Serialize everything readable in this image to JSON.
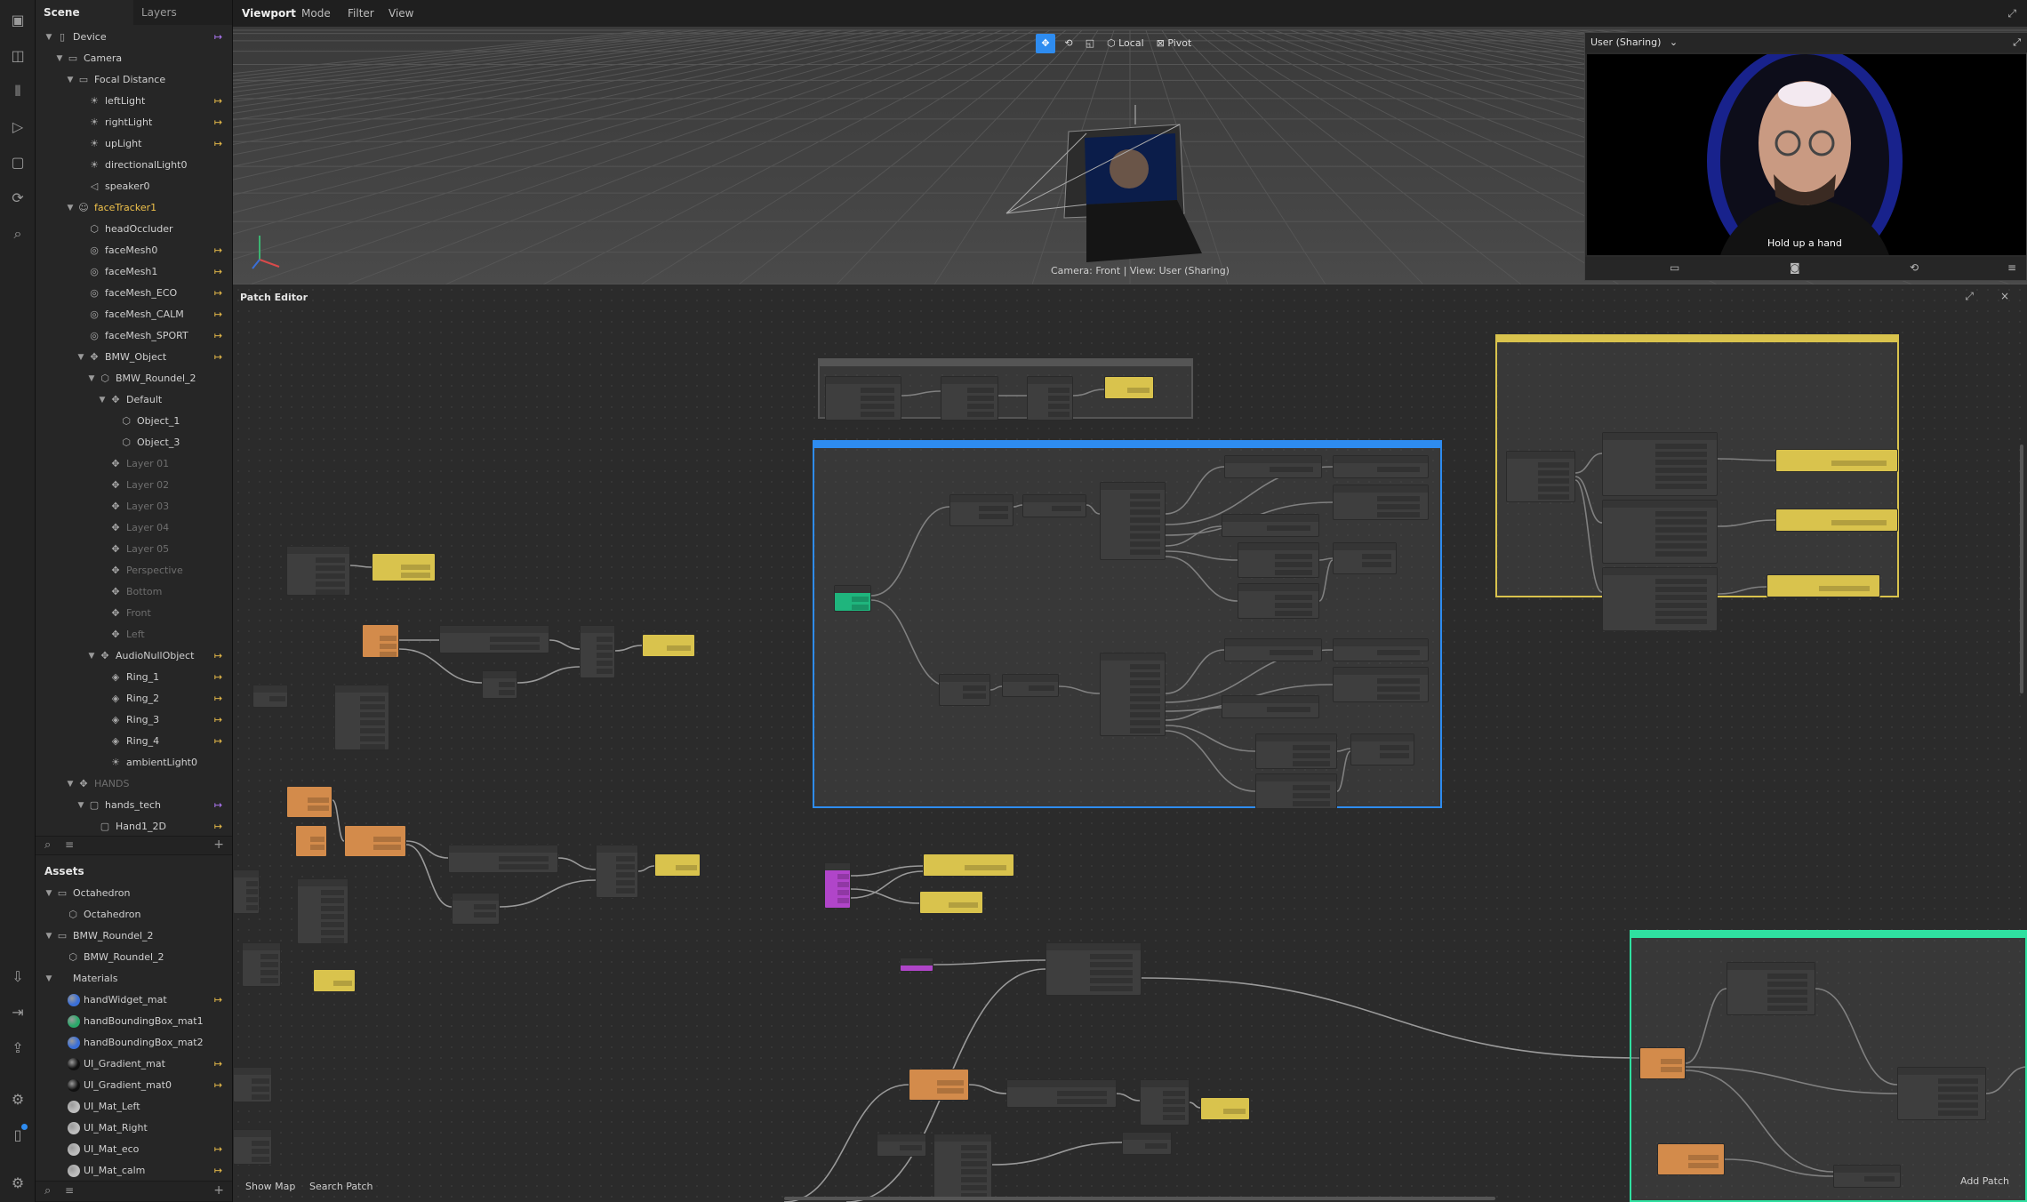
{
  "toolbar": {
    "icons": [
      "layout-icon",
      "camera-icon",
      "columns-icon",
      "play-icon",
      "square-icon",
      "sync-icon",
      "search-icon",
      "import-icon",
      "export-icon",
      "share-icon",
      "debug-icon",
      "device-icon",
      "settings-icon"
    ]
  },
  "scene": {
    "tabs": [
      "Scene",
      "Layers"
    ],
    "rows": [
      {
        "label": "Device",
        "depth": 0,
        "arrow": "▼",
        "icon": "▯",
        "pin": "↦",
        "pin_color": "purple"
      },
      {
        "label": "Camera",
        "depth": 1,
        "arrow": "▼",
        "icon": "▭"
      },
      {
        "label": "Focal Distance",
        "depth": 2,
        "arrow": "▼",
        "icon": "▭"
      },
      {
        "label": "leftLight",
        "depth": 3,
        "icon": "☀",
        "pin": "↦"
      },
      {
        "label": "rightLight",
        "depth": 3,
        "icon": "☀",
        "pin": "↦"
      },
      {
        "label": "upLight",
        "depth": 3,
        "icon": "☀",
        "pin": "↦"
      },
      {
        "label": "directionalLight0",
        "depth": 3,
        "icon": "☀"
      },
      {
        "label": "speaker0",
        "depth": 3,
        "icon": "◁"
      },
      {
        "label": "faceTracker1",
        "depth": 2,
        "arrow": "▼",
        "icon": "☺",
        "highlight": true
      },
      {
        "label": "headOccluder",
        "depth": 3,
        "icon": "⬡"
      },
      {
        "label": "faceMesh0",
        "depth": 3,
        "icon": "◎",
        "pin": "↦"
      },
      {
        "label": "faceMesh1",
        "depth": 3,
        "icon": "◎",
        "pin": "↦"
      },
      {
        "label": "faceMesh_ECO",
        "depth": 3,
        "icon": "◎",
        "pin": "↦"
      },
      {
        "label": "faceMesh_CALM",
        "depth": 3,
        "icon": "◎",
        "pin": "↦"
      },
      {
        "label": "faceMesh_SPORT",
        "depth": 3,
        "icon": "◎",
        "pin": "↦"
      },
      {
        "label": "BMW_Object",
        "depth": 3,
        "arrow": "▼",
        "icon": "✥",
        "pin": "↦"
      },
      {
        "label": "BMW_Roundel_2",
        "depth": 4,
        "arrow": "▼",
        "icon": "⬡"
      },
      {
        "label": "Default",
        "depth": 5,
        "arrow": "▼",
        "icon": "✥"
      },
      {
        "label": "Object_1",
        "depth": 6,
        "icon": "⬡"
      },
      {
        "label": "Object_3",
        "depth": 6,
        "icon": "⬡"
      },
      {
        "label": "Layer 01",
        "depth": 5,
        "icon": "✥",
        "dim": true
      },
      {
        "label": "Layer 02",
        "depth": 5,
        "icon": "✥",
        "dim": true
      },
      {
        "label": "Layer 03",
        "depth": 5,
        "icon": "✥",
        "dim": true
      },
      {
        "label": "Layer 04",
        "depth": 5,
        "icon": "✥",
        "dim": true
      },
      {
        "label": "Layer 05",
        "depth": 5,
        "icon": "✥",
        "dim": true
      },
      {
        "label": "Perspective",
        "depth": 5,
        "icon": "✥",
        "dim": true
      },
      {
        "label": "Bottom",
        "depth": 5,
        "icon": "✥",
        "dim": true
      },
      {
        "label": "Front",
        "depth": 5,
        "icon": "✥",
        "dim": true
      },
      {
        "label": "Left",
        "depth": 5,
        "icon": "✥",
        "dim": true
      },
      {
        "label": "AudioNullObject",
        "depth": 4,
        "arrow": "▼",
        "icon": "✥",
        "pin": "↦"
      },
      {
        "label": "Ring_1",
        "depth": 5,
        "icon": "◈",
        "pin": "↦"
      },
      {
        "label": "Ring_2",
        "depth": 5,
        "icon": "◈",
        "pin": "↦"
      },
      {
        "label": "Ring_3",
        "depth": 5,
        "icon": "◈",
        "pin": "↦"
      },
      {
        "label": "Ring_4",
        "depth": 5,
        "icon": "◈",
        "pin": "↦"
      },
      {
        "label": "ambientLight0",
        "depth": 5,
        "icon": "☀"
      },
      {
        "label": "HANDS",
        "depth": 2,
        "arrow": "▼",
        "icon": "✥",
        "dim": true
      },
      {
        "label": "hands_tech",
        "depth": 3,
        "arrow": "▼",
        "icon": "▢",
        "pin": "↦",
        "pin_color": "purple"
      },
      {
        "label": "Hand1_2D",
        "depth": 4,
        "icon": "▢",
        "pin": "↦"
      }
    ]
  },
  "assets": {
    "title": "Assets",
    "rows": [
      {
        "label": "Octahedron",
        "depth": 0,
        "arrow": "▼",
        "icon": "▭"
      },
      {
        "label": "Octahedron",
        "depth": 1,
        "icon": "⬡"
      },
      {
        "label": "BMW_Roundel_2",
        "depth": 0,
        "arrow": "▼",
        "icon": "▭"
      },
      {
        "label": "BMW_Roundel_2",
        "depth": 1,
        "icon": "⬡"
      },
      {
        "label": "Materials",
        "depth": 0,
        "arrow": "▼",
        "icon": ""
      },
      {
        "label": "handWidget_mat",
        "depth": 1,
        "ball": "#3a6fd8",
        "pin": "↦"
      },
      {
        "label": "handBoundingBox_mat1",
        "depth": 1,
        "ball": "#2aa86a"
      },
      {
        "label": "handBoundingBox_mat2",
        "depth": 1,
        "ball": "#3a6fd8"
      },
      {
        "label": "UI_Gradient_mat",
        "depth": 1,
        "ball": "#111111",
        "pin": "↦"
      },
      {
        "label": "UI_Gradient_mat0",
        "depth": 1,
        "ball": "#111111",
        "pin": "↦"
      },
      {
        "label": "UI_Mat_Left",
        "depth": 1,
        "ball": "#bdbdbd"
      },
      {
        "label": "UI_Mat_Right",
        "depth": 1,
        "ball": "#bdbdbd"
      },
      {
        "label": "UI_Mat_eco",
        "depth": 1,
        "ball": "#bdbdbd",
        "pin": "↦"
      },
      {
        "label": "UI_Mat_calm",
        "depth": 1,
        "ball": "#bdbdbd",
        "pin": "↦"
      }
    ]
  },
  "viewport": {
    "title": "Viewport",
    "menu": [
      "Mode",
      "Filter",
      "View"
    ],
    "tools": {
      "local": "Local",
      "pivot": "Pivot"
    },
    "camera_label": "Camera: Front | View: User (Sharing)"
  },
  "video": {
    "user": "User (Sharing)",
    "caption": "Hold up a hand"
  },
  "patch": {
    "title": "Patch Editor",
    "show_map": "Show Map",
    "search_patch": "Search Patch",
    "add_patch": "Add Patch",
    "colors": {
      "yellow": "#d9c34d",
      "orange": "#d38b4b",
      "green": "#1fb57d",
      "purple": "#b045c9",
      "blue": "#2e8cf0",
      "groupgreen": "#2fe0a0"
    }
  }
}
